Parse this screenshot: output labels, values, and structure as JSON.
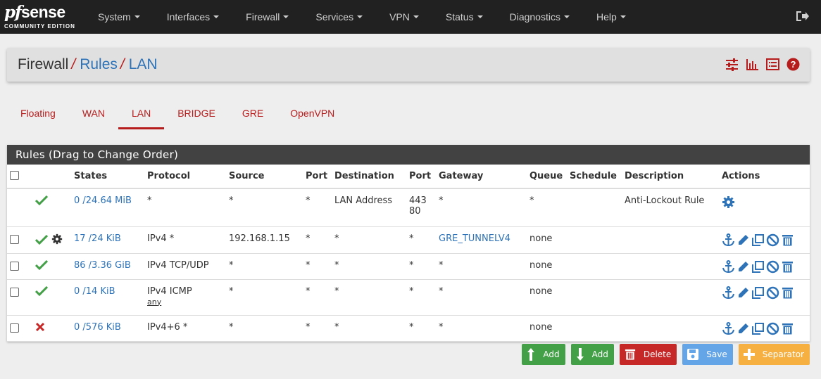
{
  "logo": {
    "brand_pf": "pf",
    "brand_sense": "sense",
    "edition": "COMMUNITY EDITION"
  },
  "nav": {
    "items": [
      {
        "label": "System"
      },
      {
        "label": "Interfaces"
      },
      {
        "label": "Firewall"
      },
      {
        "label": "Services"
      },
      {
        "label": "VPN"
      },
      {
        "label": "Status"
      },
      {
        "label": "Diagnostics"
      },
      {
        "label": "Help"
      }
    ]
  },
  "breadcrumb": {
    "root": "Firewall",
    "sep": "/",
    "level1": "Rules",
    "level2": "LAN"
  },
  "tabs": [
    {
      "label": "Floating"
    },
    {
      "label": "WAN"
    },
    {
      "label": "LAN",
      "active": true
    },
    {
      "label": "BRIDGE"
    },
    {
      "label": "GRE"
    },
    {
      "label": "OpenVPN"
    }
  ],
  "panel": {
    "title": "Rules (Drag to Change Order)"
  },
  "table": {
    "headers": [
      "States",
      "Protocol",
      "Source",
      "Port",
      "Destination",
      "Port",
      "Gateway",
      "Queue",
      "Schedule",
      "Description",
      "Actions"
    ],
    "rows": [
      {
        "status": "pass",
        "states": "0 /24.64 MiB",
        "protocol": "*",
        "protocol_sub": "",
        "source": "*",
        "sport": "*",
        "destination": "LAN Address",
        "dport1": "443",
        "dport2": "80",
        "gateway": "*",
        "queue": "*",
        "schedule": "",
        "description": "Anti-Lockout Rule"
      },
      {
        "status": "pass",
        "states": "17 /24 KiB",
        "protocol": "IPv4 *",
        "protocol_sub": "",
        "source": "192.168.1.15",
        "sport": "*",
        "destination": "*",
        "dport1": "*",
        "dport2": "",
        "gateway": "GRE_TUNNELV4",
        "queue": "none",
        "schedule": "",
        "description": ""
      },
      {
        "status": "pass",
        "states": "86 /3.36 GiB",
        "protocol": "IPv4 TCP/UDP",
        "protocol_sub": "",
        "source": "*",
        "sport": "*",
        "destination": "*",
        "dport1": "*",
        "dport2": "",
        "gateway": "*",
        "queue": "none",
        "schedule": "",
        "description": ""
      },
      {
        "status": "pass",
        "states": "0 /14 KiB",
        "protocol": "IPv4 ICMP",
        "protocol_sub": "any",
        "source": "*",
        "sport": "*",
        "destination": "*",
        "dport1": "*",
        "dport2": "",
        "gateway": "*",
        "queue": "none",
        "schedule": "",
        "description": ""
      },
      {
        "status": "block",
        "states": "0 /576 KiB",
        "protocol": "IPv4+6 *",
        "protocol_sub": "",
        "source": "*",
        "sport": "*",
        "destination": "*",
        "dport1": "*",
        "dport2": "",
        "gateway": "*",
        "queue": "none",
        "schedule": "",
        "description": ""
      }
    ]
  },
  "buttons": {
    "add_top": "Add",
    "add_bottom": "Add",
    "delete": "Delete",
    "save": "Save",
    "separator": "Separator"
  },
  "colors": {
    "accent": "#b71c1c",
    "link": "#2e73b8",
    "pass": "#43a047",
    "block": "#c62828"
  }
}
